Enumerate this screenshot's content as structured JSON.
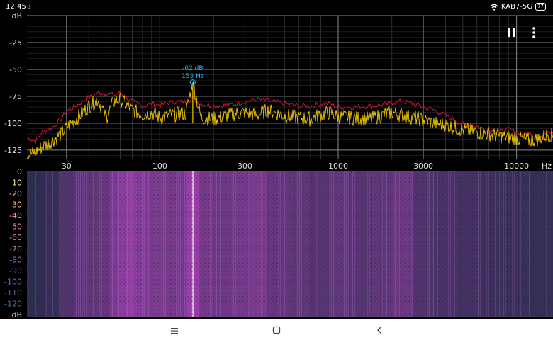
{
  "status": {
    "time": "12:45",
    "sim_icon": "sim-card-icon",
    "wifi_icon": "wifi-icon",
    "network": "KAB7-5G",
    "battery": "77"
  },
  "toolbar": {
    "pause_icon": "pause-icon",
    "menu_icon": "more-vertical-icon"
  },
  "chart_data": [
    {
      "type": "line",
      "title": "",
      "xscale": "log",
      "xlim": [
        18,
        16000
      ],
      "ylim": [
        -133,
        0
      ],
      "xlabel": "Hz",
      "ylabel": "dB",
      "x_ticks": [
        "30",
        "100",
        "300",
        "1000",
        "3000",
        "10000"
      ],
      "x_tick_values": [
        30,
        100,
        300,
        1000,
        3000,
        10000
      ],
      "y_ticks": [
        "dB",
        "-25",
        "-50",
        "-75",
        "-100",
        "-125"
      ],
      "y_tick_values": [
        0,
        -25,
        -50,
        -75,
        -100,
        -125
      ],
      "grid": true,
      "peak": {
        "x": 153,
        "y": -62,
        "label_db": "-62 dB",
        "label_hz": "153 Hz"
      },
      "series": [
        {
          "color": "#d9143c",
          "x": [
            18,
            20,
            22,
            25,
            28,
            30,
            33,
            36,
            40,
            45,
            50,
            55,
            60,
            65,
            70,
            80,
            90,
            100,
            120,
            140,
            153,
            170,
            200,
            250,
            300,
            350,
            400,
            500,
            600,
            700,
            800,
            900,
            1000,
            1200,
            1500,
            1800,
            2000,
            2200,
            2500,
            3000,
            3500,
            4000,
            5000,
            6000,
            7000,
            8000,
            9000,
            10000,
            11000,
            12000,
            13000,
            14000,
            15000,
            16000
          ],
          "values": [
            -113,
            -117,
            -108,
            -104,
            -96,
            -89,
            -85,
            -81,
            -76,
            -72,
            -72,
            -74,
            -72,
            -76,
            -80,
            -84,
            -82,
            -83,
            -80,
            -80,
            -77,
            -82,
            -84,
            -83,
            -80,
            -78,
            -79,
            -82,
            -84,
            -84,
            -82,
            -82,
            -85,
            -85,
            -84,
            -83,
            -81,
            -80,
            -81,
            -85,
            -88,
            -93,
            -101,
            -103,
            -107,
            -108,
            -106,
            -108,
            -111,
            -110,
            -113,
            -112,
            -106,
            -108
          ]
        },
        {
          "color": "#f0c800",
          "x": [
            18,
            20,
            22,
            25,
            28,
            30,
            33,
            36,
            40,
            45,
            50,
            55,
            60,
            65,
            70,
            80,
            90,
            100,
            120,
            140,
            153,
            170,
            200,
            250,
            300,
            350,
            400,
            500,
            600,
            700,
            800,
            900,
            1000,
            1200,
            1500,
            1800,
            2000,
            2200,
            2500,
            3000,
            3500,
            4000,
            5000,
            6000,
            7000,
            8000,
            9000,
            10000,
            11000,
            12000,
            13000,
            14000,
            15000,
            16000
          ],
          "values": [
            -130,
            -127,
            -122,
            -116,
            -110,
            -104,
            -98,
            -92,
            -84,
            -78,
            -95,
            -80,
            -78,
            -83,
            -88,
            -92,
            -90,
            -95,
            -92,
            -91,
            -62,
            -95,
            -96,
            -92,
            -90,
            -93,
            -88,
            -93,
            -95,
            -96,
            -92,
            -90,
            -94,
            -95,
            -96,
            -92,
            -90,
            -92,
            -94,
            -97,
            -100,
            -102,
            -106,
            -108,
            -110,
            -112,
            -113,
            -114,
            -115,
            -116,
            -115,
            -113,
            -110,
            -112
          ]
        }
      ]
    },
    {
      "type": "heatmap",
      "title": "",
      "xscale": "log",
      "xlim": [
        18,
        16000
      ],
      "ylabel": "dB",
      "scale_labels": [
        "0",
        "-10",
        "-20",
        "-30",
        "-40",
        "-50",
        "-60",
        "-70",
        "-80",
        "-90",
        "-100",
        "-110",
        "-120",
        "dB"
      ],
      "marker": {
        "x": 153,
        "label": "153"
      },
      "band_x": [
        20,
        25,
        30,
        35,
        42,
        50,
        55,
        60,
        70,
        80,
        100,
        130,
        153,
        180,
        220,
        280,
        350,
        450,
        600,
        800,
        1000,
        1300,
        1800,
        2300,
        3000,
        4000,
        5500,
        7500,
        10000,
        14000
      ],
      "band_intensity": [
        0.2,
        0.25,
        0.45,
        0.5,
        0.55,
        0.6,
        0.75,
        0.85,
        0.9,
        0.8,
        0.75,
        0.7,
        0.95,
        0.7,
        0.65,
        0.7,
        0.75,
        0.6,
        0.55,
        0.5,
        0.55,
        0.5,
        0.55,
        0.65,
        0.45,
        0.4,
        0.35,
        0.3,
        0.28,
        0.25
      ]
    }
  ]
}
